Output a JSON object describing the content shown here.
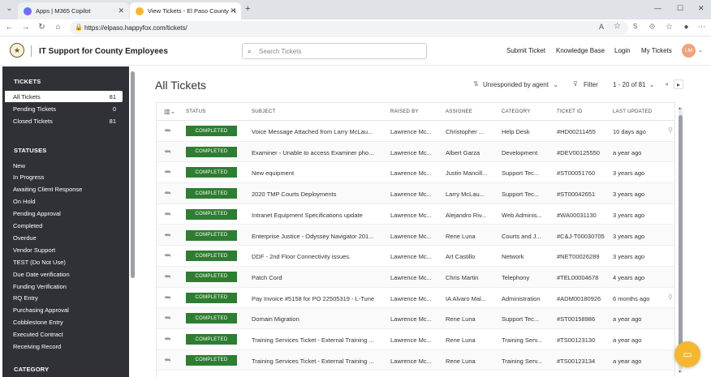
{
  "browser": {
    "tabs": [
      {
        "title": "Apps | M365 Copilot"
      },
      {
        "title": "View Tickets - El Paso County - IT"
      }
    ],
    "new_tab": "+",
    "url": "https://elpaso.happyfox.com/tickets/"
  },
  "header": {
    "site_title": "IT Support for County Employees",
    "search_placeholder": "Search Tickets",
    "links": [
      "Submit Ticket",
      "Knowledge Base",
      "Login",
      "My Tickets"
    ],
    "avatar_initials": "LM"
  },
  "sidebar": {
    "tickets_heading": "TICKETS",
    "ticket_views": [
      {
        "label": "All Tickets",
        "count": "81"
      },
      {
        "label": "Pending Tickets",
        "count": "0"
      },
      {
        "label": "Closed Tickets",
        "count": "81"
      }
    ],
    "statuses_heading": "STATUSES",
    "statuses": [
      "New",
      "In Progress",
      "Awaiting Client Response",
      "On Hold",
      "Pending Approval",
      "Completed",
      "Overdue",
      "Vendor Support",
      "TEST (Do Not Use)",
      "Due Date verification",
      "Funding Verification",
      "RQ Entry",
      "Purchasing Approval",
      "Cobblestone Entry",
      "Executed Contract",
      "Receiving Record"
    ],
    "category_heading": "CATEGORY"
  },
  "main": {
    "title": "All Tickets",
    "sort_label": "Unresponded by agent",
    "filter_label": "Filter",
    "pagination": "1 - 20 of 81",
    "columns": [
      "STATUS",
      "SUBJECT",
      "RAISED BY",
      "ASSIGNEE",
      "CATEGORY",
      "TICKET ID",
      "LAST UPDATED"
    ],
    "rows": [
      {
        "status": "COMPLETED",
        "subject": "Voice Message Attached from Larry McLau...",
        "raised_by": "Lawrence Mc...",
        "assignee": "Christopher ...",
        "category": "Help Desk",
        "ticket_id": "#HD00211455",
        "updated": "10 days ago",
        "attachment": true
      },
      {
        "status": "COMPLETED",
        "subject": "Examiner - Unable to access Examiner pho...",
        "raised_by": "Lawrence Mc...",
        "assignee": "Albert Garza",
        "category": "Development",
        "ticket_id": "#DEV00125550",
        "updated": "a year ago",
        "attachment": false
      },
      {
        "status": "COMPLETED",
        "subject": "New equipment",
        "raised_by": "Lawrence Mc...",
        "assignee": "Justin Mancill...",
        "category": "Support Tec...",
        "ticket_id": "#ST00051760",
        "updated": "3 years ago",
        "attachment": false
      },
      {
        "status": "COMPLETED",
        "subject": "2020 TMP Courts Deployments",
        "raised_by": "Lawrence Mc...",
        "assignee": "Larry McLau...",
        "category": "Support Tec...",
        "ticket_id": "#ST00042651",
        "updated": "3 years ago",
        "attachment": false
      },
      {
        "status": "COMPLETED",
        "subject": "Intranet Equipment Specifications update",
        "raised_by": "Lawrence Mc...",
        "assignee": "Alejandro Riv...",
        "category": "Web Adminis...",
        "ticket_id": "#WA00031130",
        "updated": "3 years ago",
        "attachment": false
      },
      {
        "status": "COMPLETED",
        "subject": "Enterprise Justice - Odyssey Navigator 201...",
        "raised_by": "Lawrence Mc...",
        "assignee": "Rene Luna",
        "category": "Courts and J...",
        "ticket_id": "#C&J-T00030705",
        "updated": "3 years ago",
        "attachment": false
      },
      {
        "status": "COMPLETED",
        "subject": "DDF - 2nd Floor Connectivity issues.",
        "raised_by": "Lawrence Mc...",
        "assignee": "Art Castillo",
        "category": "Network",
        "ticket_id": "#NET00026289",
        "updated": "3 years ago",
        "attachment": false
      },
      {
        "status": "COMPLETED",
        "subject": "Patch Cord",
        "raised_by": "Lawrence Mc...",
        "assignee": "Chris Martin",
        "category": "Telephony",
        "ticket_id": "#TEL00004678",
        "updated": "4 years ago",
        "attachment": false
      },
      {
        "status": "COMPLETED",
        "subject": "Pay Invoice #5158 for PO 22505319 - L-Tune",
        "raised_by": "Lawrence Mc...",
        "assignee": "IA Alvaro Mal...",
        "category": "Administration",
        "ticket_id": "#ADM00180926",
        "updated": "6 months ago",
        "attachment": true
      },
      {
        "status": "COMPLETED",
        "subject": "Domain Migration",
        "raised_by": "Lawrence Mc...",
        "assignee": "Rene Luna",
        "category": "Support Tec...",
        "ticket_id": "#ST00158986",
        "updated": "a year ago",
        "attachment": false
      },
      {
        "status": "COMPLETED",
        "subject": "Training Services Ticket - External Training ...",
        "raised_by": "Lawrence Mc...",
        "assignee": "Rene Luna",
        "category": "Training Serv...",
        "ticket_id": "#TS00123130",
        "updated": "a year ago",
        "attachment": false
      },
      {
        "status": "COMPLETED",
        "subject": "Training Services Ticket - External Training ...",
        "raised_by": "Lawrence Mc...",
        "assignee": "Rene Luna",
        "category": "Training Serv...",
        "ticket_id": "#TS00123134",
        "updated": "a year ago",
        "attachment": false
      }
    ]
  },
  "colors": {
    "status_completed": "#2e7d32",
    "sidebar_bg": "#2f3136",
    "chat_button": "#f5b731"
  },
  "icons": {
    "reply": "reply-icon",
    "attachment": "paperclip-icon",
    "chat": "chat-icon"
  }
}
